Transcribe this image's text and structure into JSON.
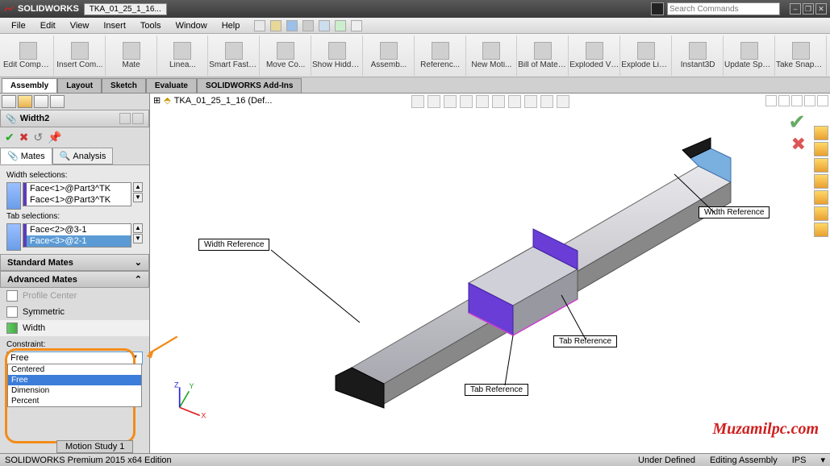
{
  "app": {
    "name": "SOLIDWORKS",
    "doc_title": "TKA_01_25_1_16..."
  },
  "menu": {
    "file": "File",
    "edit": "Edit",
    "view": "View",
    "insert": "Insert",
    "tools": "Tools",
    "window": "Window",
    "help": "Help"
  },
  "search": {
    "placeholder": "Search Commands"
  },
  "ribbon": {
    "items": [
      "Edit Component",
      "Insert Com...",
      "Mate",
      "Linea...",
      "Smart Fasteners",
      "Move Co...",
      "Show Hidde...",
      "Assemb...",
      "Referenc...",
      "New Moti...",
      "Bill of Materials",
      "Exploded View",
      "Explode Line...",
      "Instant3D",
      "Update Speedpak",
      "Take Snapshot"
    ]
  },
  "tabs": {
    "items": [
      "Assembly",
      "Layout",
      "Sketch",
      "Evaluate",
      "SOLIDWORKS Add-Ins"
    ],
    "active": 0
  },
  "feature_tree": {
    "root": "TKA_01_25_1_16  (Def..."
  },
  "pm": {
    "title": "Width2",
    "mates_tab": "Mates",
    "analysis_tab": "Analysis",
    "width_sel_label": "Width selections:",
    "width_sel_items": [
      "Face<1>@Part3^TK",
      "Face<1>@Part3^TK"
    ],
    "tab_sel_label": "Tab selections:",
    "tab_sel_items": [
      "Face<2>@3-1",
      "Face<3>@2-1"
    ],
    "std_mates": "Standard Mates",
    "adv_mates": "Advanced Mates",
    "profile_center": "Profile Center",
    "symmetric": "Symmetric",
    "width_mate": "Width",
    "constraint_label": "Constraint:",
    "constraint_value": "Free",
    "constraint_options": [
      "Centered",
      "Free",
      "Dimension",
      "Percent"
    ]
  },
  "annotations": {
    "width_ref": "Width Reference",
    "tab_ref": "Tab Reference"
  },
  "status": {
    "edition": "SOLIDWORKS Premium 2015 x64 Edition",
    "under_defined": "Under Defined",
    "editing": "Editing Assembly",
    "units": "IPS"
  },
  "motion_study": "Motion Study 1",
  "watermark": "Muzamilpc.com"
}
